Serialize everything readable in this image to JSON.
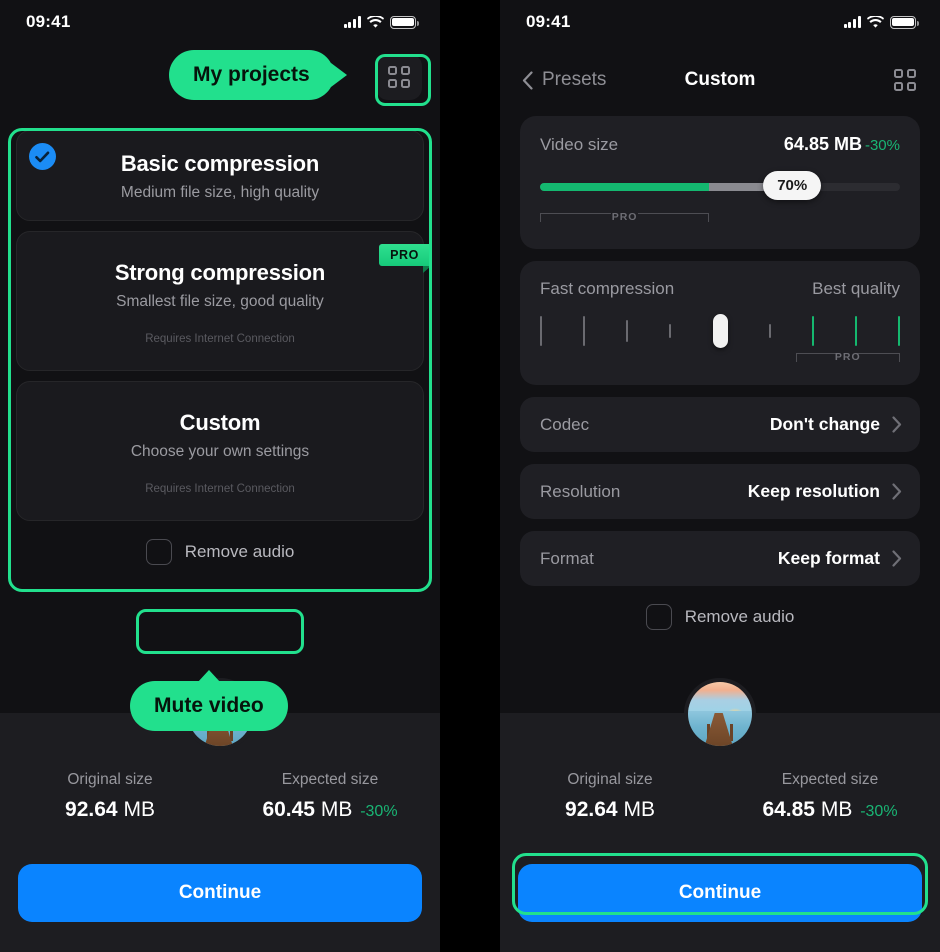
{
  "status_bar": {
    "time": "09:41",
    "signal_icon": "cellular-signal-icon",
    "wifi_icon": "wifi-icon",
    "battery_icon": "battery-full-icon"
  },
  "left_screen": {
    "nav": {
      "grid_icon": "grid-view-icon"
    },
    "tooltip_projects": "My projects",
    "presets": [
      {
        "title": "Basic compression",
        "subtitle": "Medium file size, high quality",
        "note": "",
        "selected": true,
        "pro": false
      },
      {
        "title": "Strong compression",
        "subtitle": "Smallest file size, good quality",
        "note": "Requires Internet Connection",
        "selected": false,
        "pro": true,
        "pro_label": "PRO"
      },
      {
        "title": "Custom",
        "subtitle": "Choose your own settings",
        "note": "Requires Internet Connection",
        "selected": false,
        "pro": false
      }
    ],
    "remove_audio_label": "Remove audio",
    "remove_audio_checked": false,
    "tooltip_mute": "Mute video",
    "summary": {
      "original_label": "Original size",
      "original_value": "92.64",
      "original_unit": "MB",
      "expected_label": "Expected size",
      "expected_value": "60.45",
      "expected_unit": "MB",
      "expected_delta": "-30%"
    },
    "continue_label": "Continue"
  },
  "right_screen": {
    "nav": {
      "back_label": "Presets",
      "back_icon": "chevron-left-icon",
      "title": "Custom",
      "grid_icon": "grid-view-icon"
    },
    "video_size": {
      "label": "Video size",
      "value": "64.85 MB",
      "delta": "-30%",
      "slider_value": "70%",
      "pro_label": "PRO"
    },
    "quality": {
      "left_label": "Fast compression",
      "right_label": "Best quality",
      "pro_label": "PRO",
      "tick_count": 9,
      "thumb_index": 5
    },
    "rows": [
      {
        "label": "Codec",
        "value": "Don't change",
        "chevron_icon": "chevron-right-icon"
      },
      {
        "label": "Resolution",
        "value": "Keep resolution",
        "chevron_icon": "chevron-right-icon"
      },
      {
        "label": "Format",
        "value": "Keep format",
        "chevron_icon": "chevron-right-icon"
      }
    ],
    "remove_audio_label": "Remove audio",
    "remove_audio_checked": false,
    "summary": {
      "original_label": "Original size",
      "original_value": "92.64",
      "original_unit": "MB",
      "expected_label": "Expected size",
      "expected_value": "64.85",
      "expected_unit": "MB",
      "expected_delta": "-30%"
    },
    "continue_label": "Continue"
  },
  "colors": {
    "accent_green": "#22e08d",
    "progress_green": "#14b870",
    "primary_blue": "#0a84ff",
    "check_blue": "#1b8cf5",
    "panel_bg": "#111114",
    "card_bg": "#1f1f24"
  }
}
